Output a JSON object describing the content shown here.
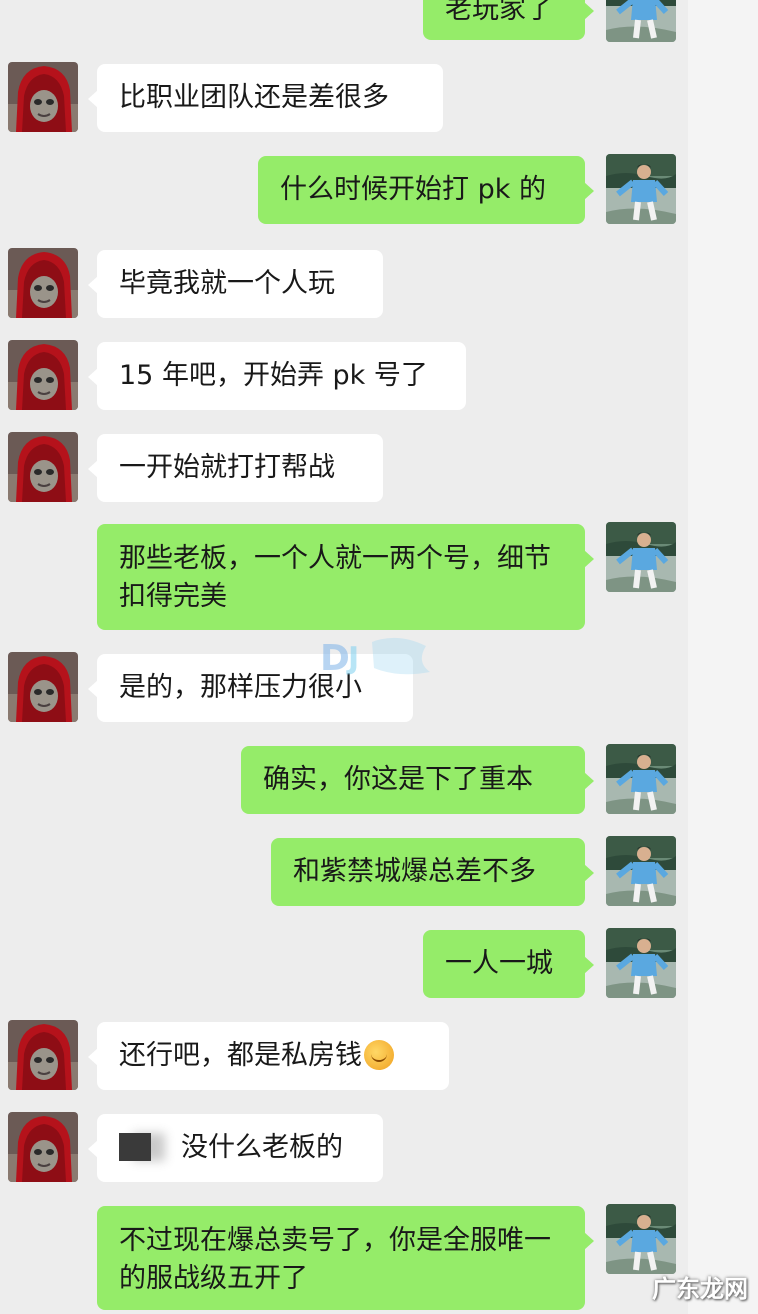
{
  "messages": [
    {
      "side": "right",
      "text": "老玩家了"
    },
    {
      "side": "left",
      "text": "比职业团队还是差很多"
    },
    {
      "side": "right",
      "text": "什么时候开始打 pk 的"
    },
    {
      "side": "left",
      "text": "毕竟我就一个人玩"
    },
    {
      "side": "left",
      "text": "15 年吧，开始弄 pk 号了"
    },
    {
      "side": "left",
      "text": "一开始就打打帮战"
    },
    {
      "side": "right",
      "text": "那些老板，一个人就一两个号，细节扣得完美"
    },
    {
      "side": "left",
      "text": "是的，那样压力很小"
    },
    {
      "side": "right",
      "text": "确实，你这是下了重本"
    },
    {
      "side": "right",
      "text": "和紫禁城爆总差不多"
    },
    {
      "side": "right",
      "text": "一人一城"
    },
    {
      "side": "left",
      "text": "还行吧，都是私房钱",
      "emoji": "facepalm-emoji"
    },
    {
      "side": "left",
      "text": "没什么老板的",
      "redacted": true
    },
    {
      "side": "right",
      "text": "不过现在爆总卖号了，你是全服唯一的服战级五开了"
    }
  ],
  "watermark": "广东龙网"
}
